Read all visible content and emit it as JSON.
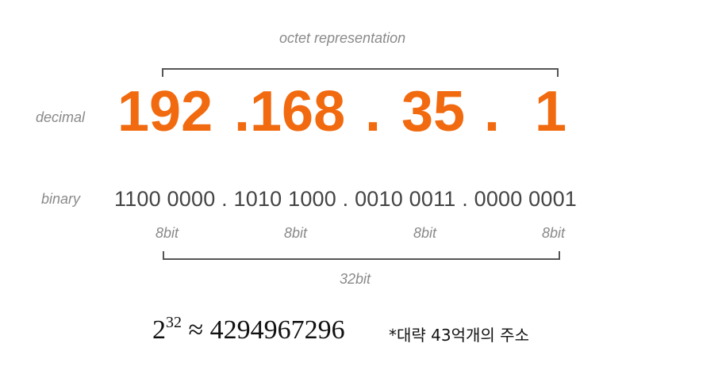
{
  "top_label": "octet representation",
  "row_labels": {
    "decimal": "decimal",
    "binary": "binary"
  },
  "decimal_octets": [
    "192",
    ".168",
    ".",
    "35",
    ".",
    "1"
  ],
  "binary": "1100 0000 . 1010 1000 . 0010 0011 . 0000 0001",
  "bit_labels": [
    "8bit",
    "8bit",
    "8bit",
    "8bit"
  ],
  "total_label": "32bit",
  "formula": {
    "base": "2",
    "exponent": "32",
    "approx": "≈",
    "value": "4294967296"
  },
  "note": "*대략 43억개의 주소",
  "colors": {
    "decimal": "#f26a0f",
    "text": "#444444",
    "label": "#8a8a8a"
  }
}
